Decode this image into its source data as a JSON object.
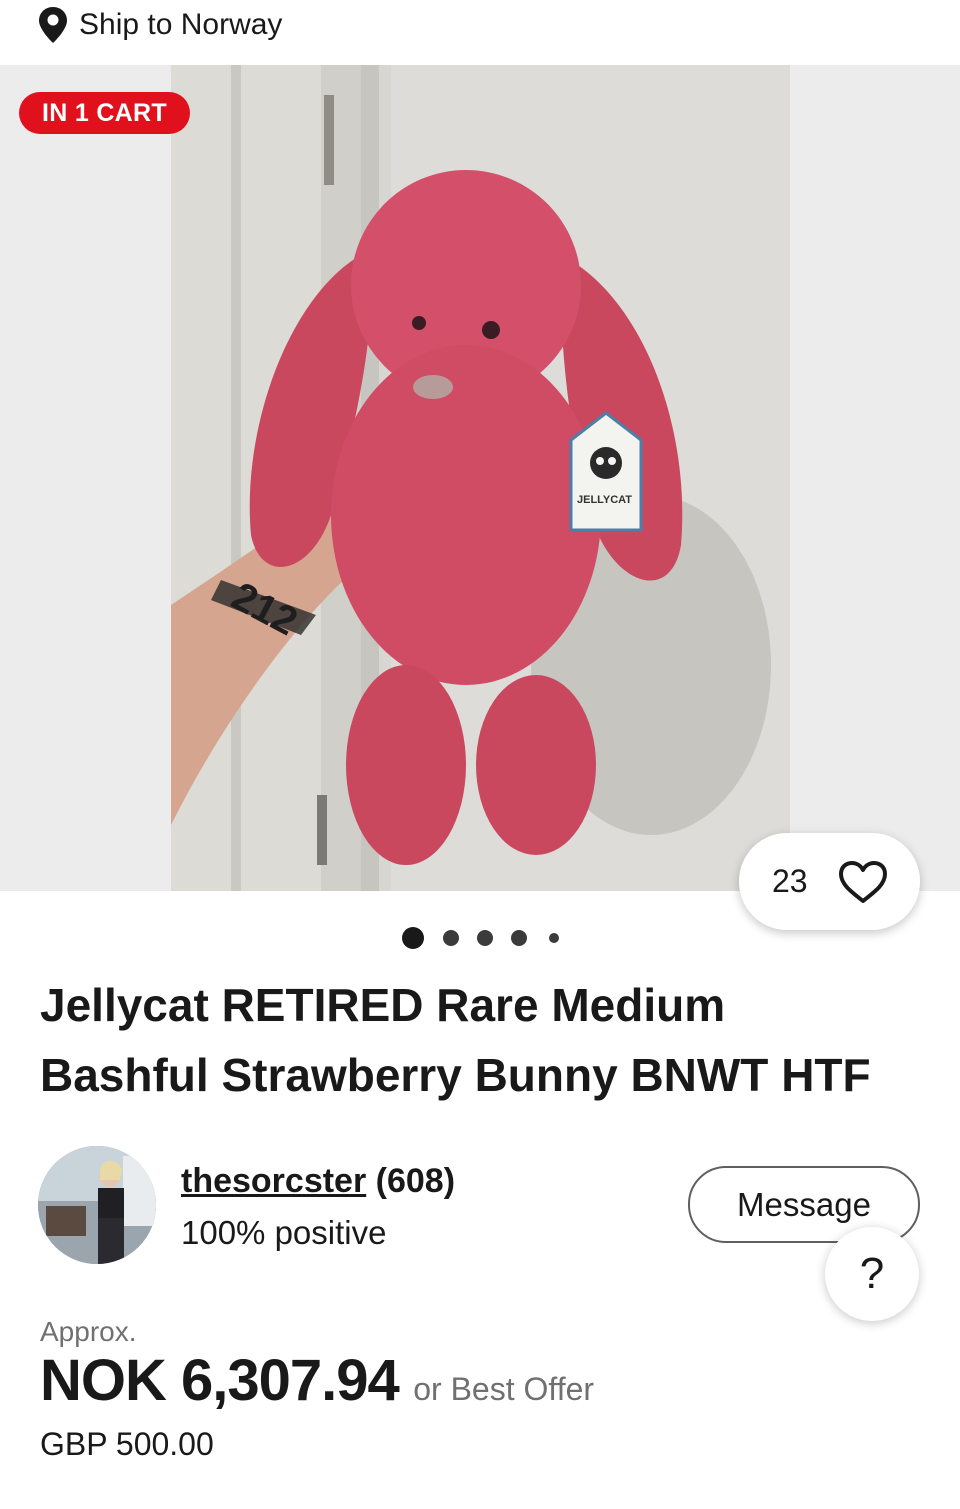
{
  "shipping": {
    "label": "Ship to Norway",
    "icon": "location-pin-icon"
  },
  "gallery": {
    "cart_badge": "IN 1 CART",
    "watch_count": "23",
    "image_count": 5,
    "active_index": 0,
    "photo_tag_text": "JELLYCAT",
    "arm_tattoo_text": "212"
  },
  "listing": {
    "title_line1": "Jellycat RETIRED Rare Medium",
    "title_line2": "Bashful Strawberry Bunny BNWT HTF"
  },
  "seller": {
    "username": "thesorcster",
    "feedback_count": "(608)",
    "positive": "100% positive"
  },
  "actions": {
    "message_label": "Message",
    "help_label": "?"
  },
  "pricing": {
    "approx_label": "Approx.",
    "price": "NOK 6,307.94",
    "offer_label": "or Best Offer",
    "original_price": "GBP 500.00"
  },
  "colors": {
    "badge_red": "#e0101c",
    "text": "#191919",
    "muted": "#707070",
    "bunny_pink": "#d4506a"
  }
}
